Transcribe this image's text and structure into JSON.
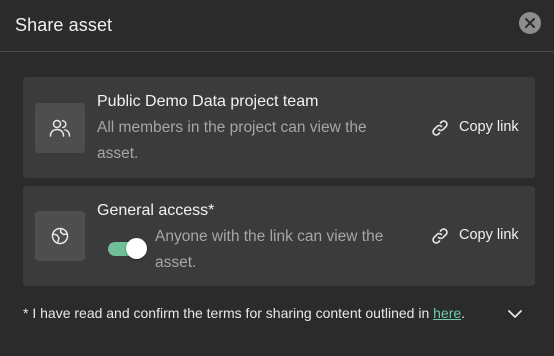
{
  "dialog": {
    "title": "Share asset"
  },
  "cards": [
    {
      "title": "Public Demo Data project team",
      "description": "All members in the project can view the asset.",
      "action_label": "Copy link",
      "icon": "users-icon"
    },
    {
      "title": "General access*",
      "description": "Anyone with the link can view the asset.",
      "action_label": "Copy link",
      "icon": "globe-icon",
      "toggle_on": true
    }
  ],
  "terms": {
    "prefix": "* I have read and confirm the terms for sharing content outlined in ",
    "link_text": "here",
    "suffix": "."
  },
  "colors": {
    "background": "#2b2b2b",
    "card": "#3b3b3b",
    "accent": "#6fbf98",
    "link": "#6fc9a7"
  }
}
